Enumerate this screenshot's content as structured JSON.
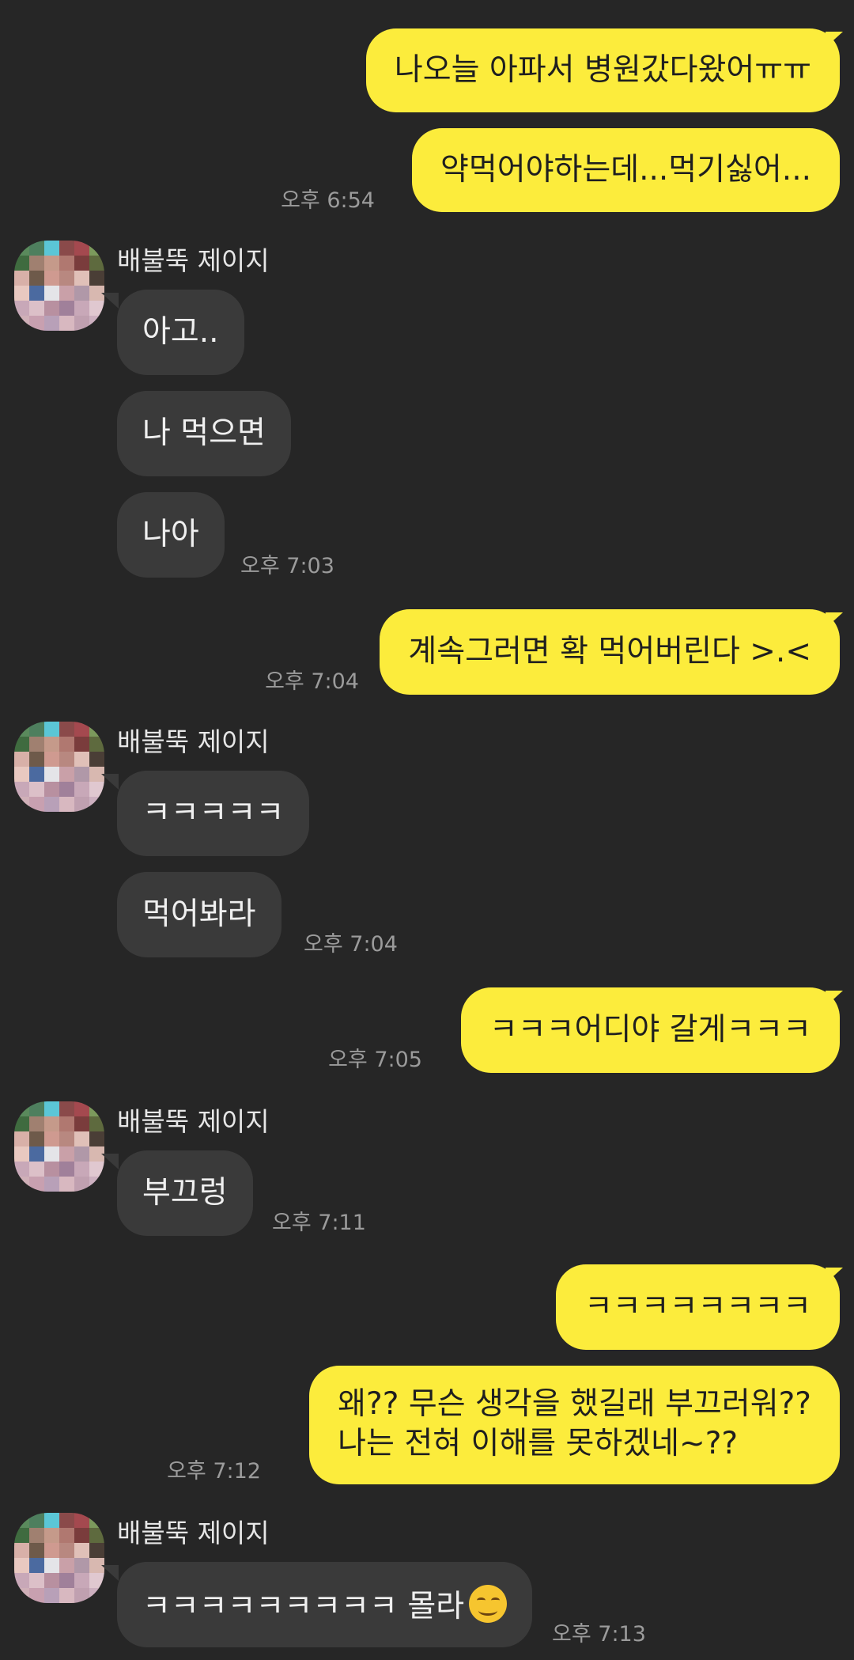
{
  "contact": {
    "name": "배불뚝 제이지",
    "avatar_icon": "pixelated-avatar-icon"
  },
  "messages": [
    {
      "sender": "me",
      "text": "나오늘 아파서 병원갔다왔어ㅠㅠ"
    },
    {
      "sender": "me",
      "text": "약먹어야하는데...먹기싫어...",
      "time": "오후 6:54"
    },
    {
      "sender": "other",
      "text": "아고.."
    },
    {
      "sender": "other",
      "text": "나 먹으면"
    },
    {
      "sender": "other",
      "text": "나아",
      "time": "오후 7:03"
    },
    {
      "sender": "me",
      "text": "계속그러면 확 먹어버린다 >.<",
      "time": "오후 7:04"
    },
    {
      "sender": "other",
      "text": "ㅋㅋㅋㅋㅋ"
    },
    {
      "sender": "other",
      "text": "먹어봐라",
      "time": "오후 7:04"
    },
    {
      "sender": "me",
      "text": "ㅋㅋㅋ어디야 갈게ㅋㅋㅋ",
      "time": "오후 7:05"
    },
    {
      "sender": "other",
      "text": "부끄렁",
      "time": "오후 7:11"
    },
    {
      "sender": "me",
      "text": "ㅋㅋㅋㅋㅋㅋㅋㅋ"
    },
    {
      "sender": "me",
      "text": "왜?? 무슨 생각을 했길래 부끄러워??",
      "text_line2": "나는 전혀 이해를 못하겠네~??",
      "time": "오후 7:12"
    },
    {
      "sender": "other",
      "text": "ㅋㅋㅋㅋㅋㅋㅋㅋㅋ 몰라",
      "emoji": "smirking-face-emoji",
      "time": "오후 7:13"
    }
  ],
  "colors": {
    "background": "#262626",
    "my_bubble": "#fcec3c",
    "other_bubble": "#3a3a3a",
    "timestamp": "#9b9b9b"
  }
}
